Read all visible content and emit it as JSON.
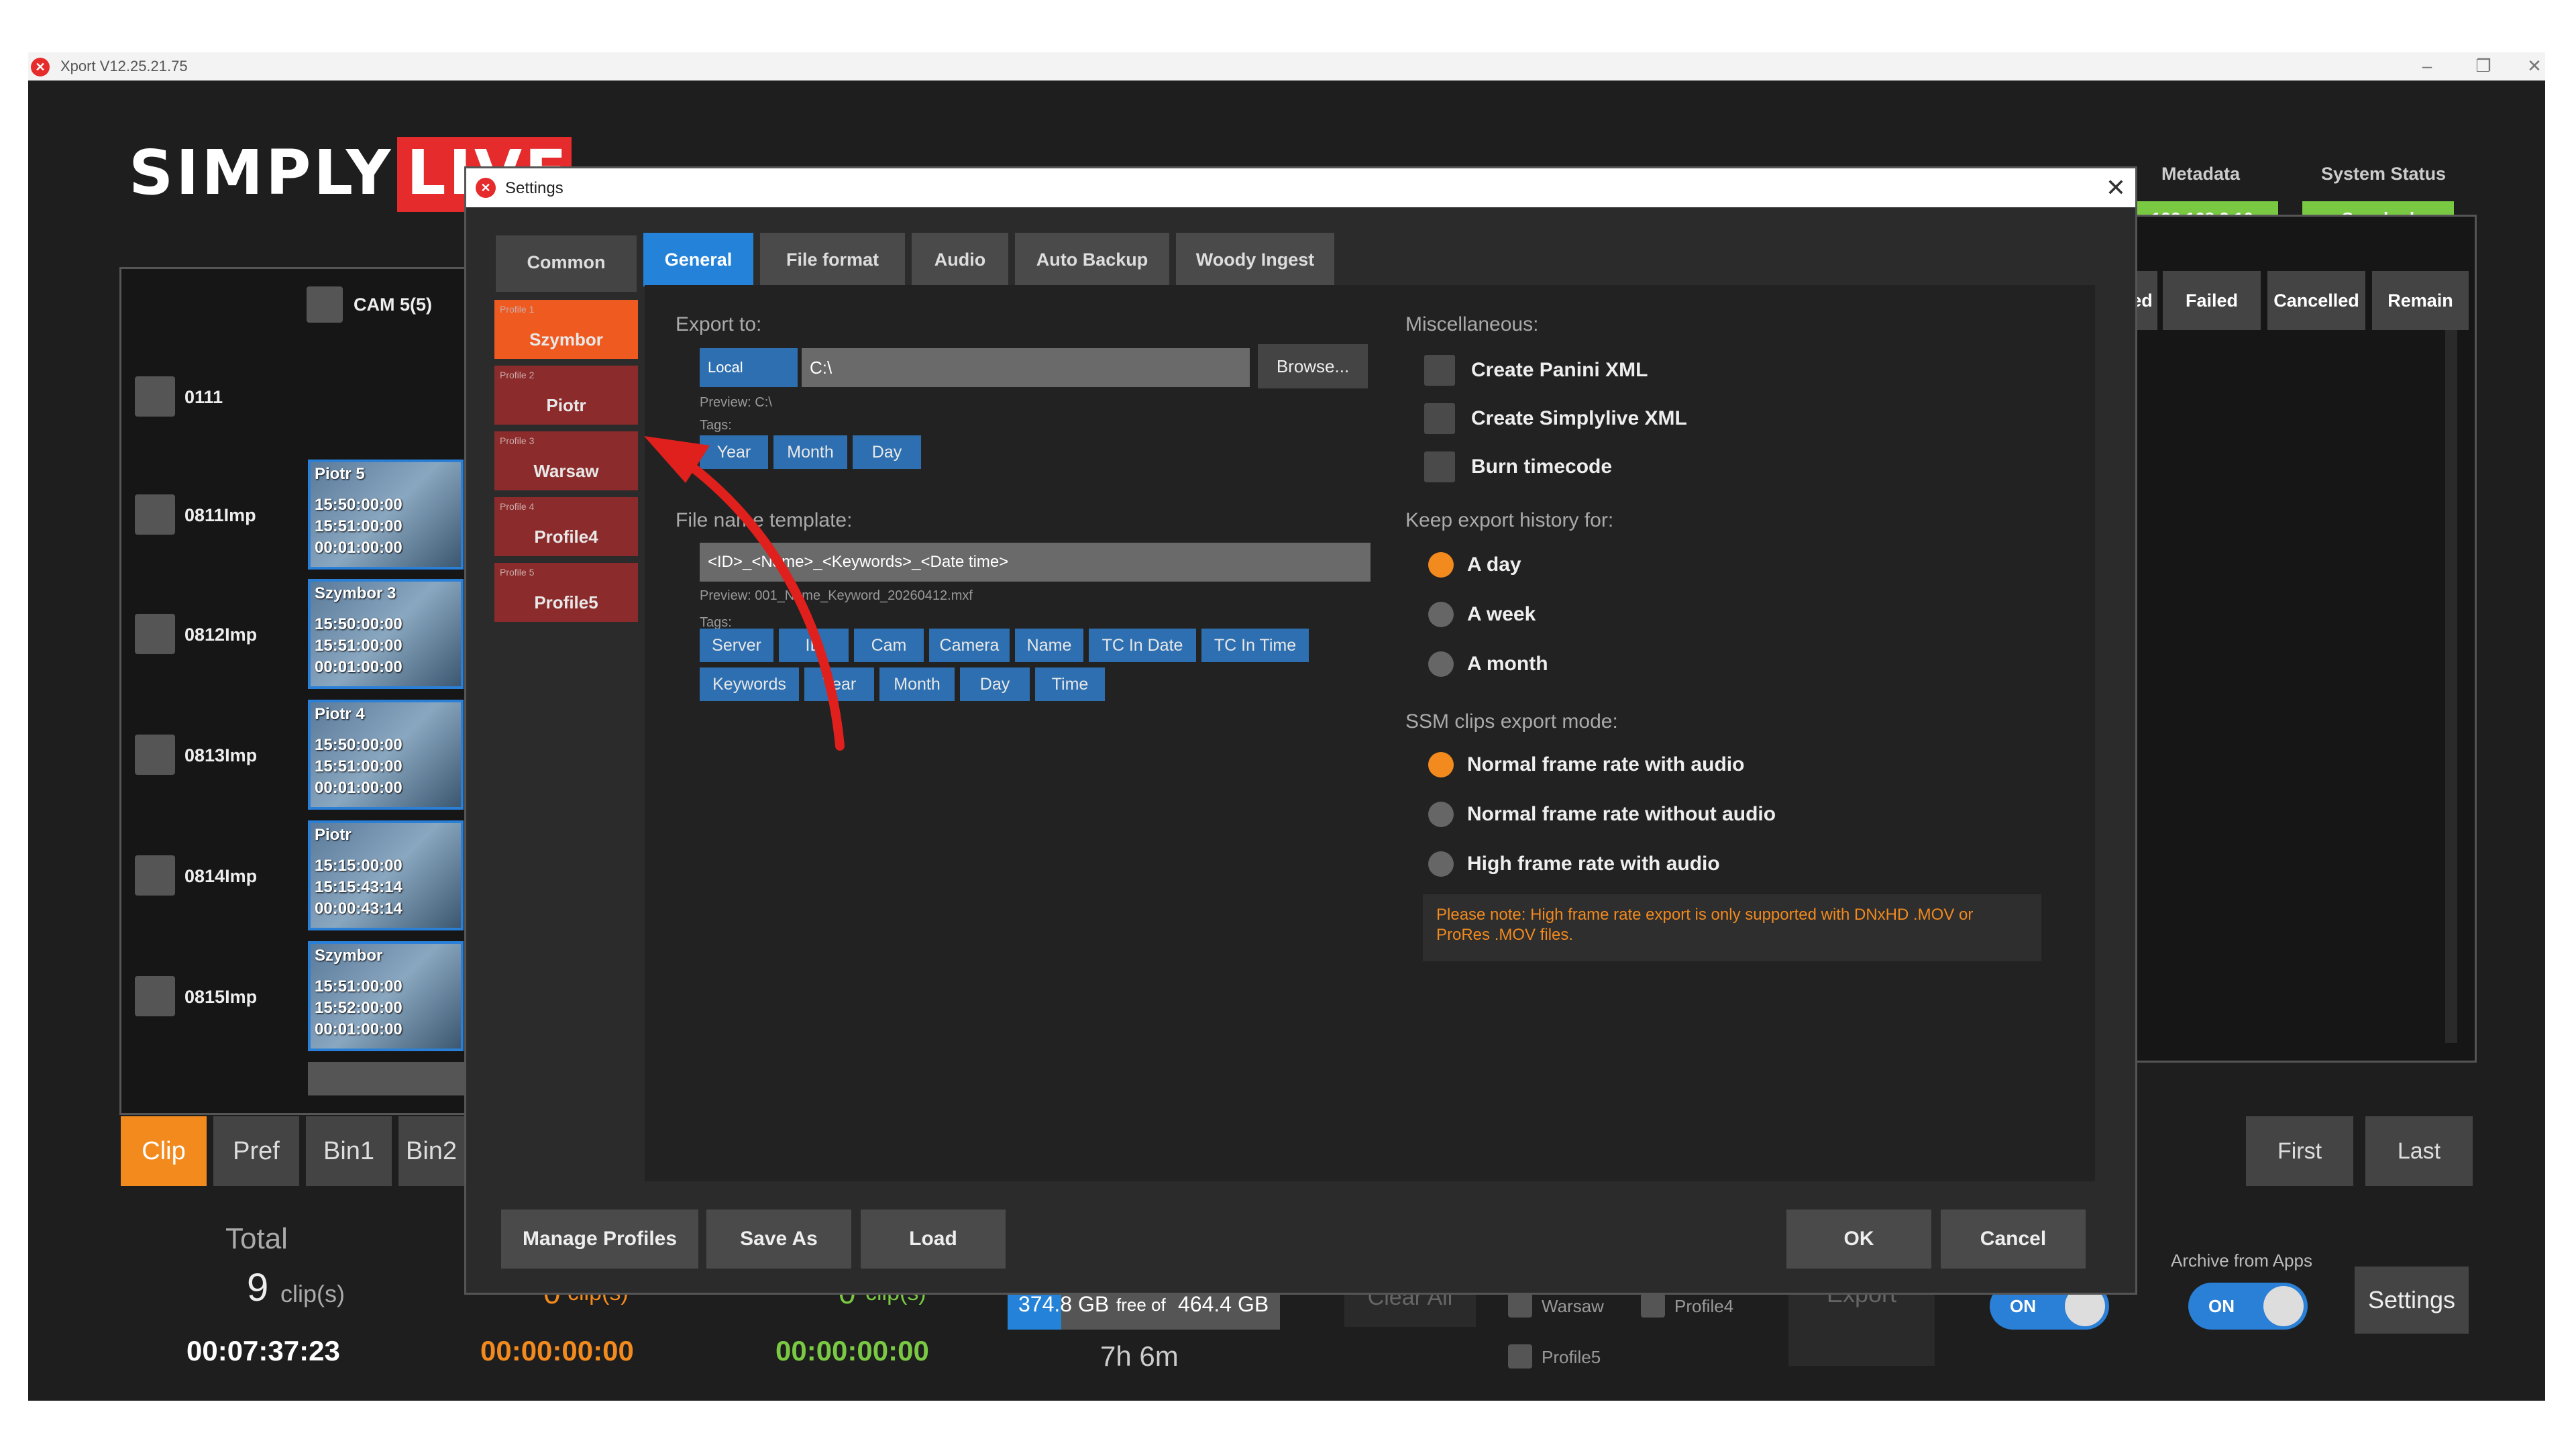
{
  "window": {
    "title": "Xport V12.25.21.75",
    "minimize": "–",
    "restore": "❐",
    "close": "✕"
  },
  "brand": {
    "part1": "SIMPLY",
    "part2": "LIVE"
  },
  "left_panel": {
    "camera_label": "CAM 5(5)",
    "rows": [
      {
        "label": "0111"
      },
      {
        "label": "0811Imp",
        "thumb": [
          "Piotr 5",
          "15:50:00:00",
          "15:51:00:00",
          "00:01:00:00"
        ]
      },
      {
        "label": "0812Imp",
        "thumb": [
          "Szymbor 3",
          "15:50:00:00",
          "15:51:00:00",
          "00:01:00:00"
        ]
      },
      {
        "label": "0813Imp",
        "thumb": [
          "Piotr 4",
          "15:50:00:00",
          "15:51:00:00",
          "00:01:00:00"
        ]
      },
      {
        "label": "0814Imp",
        "thumb": [
          "Piotr",
          "15:15:00:00",
          "15:15:43:14",
          "00:00:43:14"
        ]
      },
      {
        "label": "0815Imp",
        "thumb": [
          "Szymbor",
          "15:51:00:00",
          "15:52:00:00",
          "00:01:00:00"
        ]
      }
    ]
  },
  "right_panel": {
    "columns": [
      "ed",
      "Failed",
      "Cancelled",
      "Remain"
    ],
    "metadata_label": "Metadata",
    "metadata_value": "192.168.2.10",
    "status_label": "System Status",
    "status_value": "Synched"
  },
  "bottom": {
    "tabs": [
      "Clip",
      "Pref",
      "Bin1",
      "Bin2"
    ],
    "total_label": "Total",
    "total_count": "9",
    "clip_unit": "clip(s)",
    "total_time": "00:07:37:23",
    "col2_count": "0",
    "col2_time": "00:00:00:00",
    "col3_count": "0",
    "col3_time": "00:00:00:00",
    "disk": "374.8 GB",
    "disk_free": "free of",
    "disk_total": "464.4 GB",
    "remaining": "7h 6m",
    "clear_all": "Clear All",
    "profiles_list": [
      "Warsaw",
      "Profile4",
      "Profile5"
    ],
    "export": "Export",
    "toggle1": "ON",
    "archive_label": "Archive from Apps",
    "toggle2": "ON",
    "settings": "Settings",
    "first": "First",
    "last": "Last"
  },
  "dialog": {
    "title": "Settings",
    "close": "✕",
    "common_tab": "Common",
    "tabs": [
      "General",
      "File format",
      "Audio",
      "Auto Backup",
      "Woody Ingest"
    ],
    "profiles": [
      {
        "small": "Profile 1",
        "name": "Szymbor"
      },
      {
        "small": "Profile 2",
        "name": "Piotr"
      },
      {
        "small": "Profile 3",
        "name": "Warsaw"
      },
      {
        "small": "Profile 4",
        "name": "Profile4"
      },
      {
        "small": "Profile 5",
        "name": "Profile5"
      }
    ],
    "export_to": "Export to:",
    "location": "Local",
    "path": "C:\\",
    "browse": "Browse...",
    "preview_path": "Preview: C:\\",
    "tags_label": "Tags:",
    "path_tags": [
      "Year",
      "Month",
      "Day"
    ],
    "template_label": "File name template:",
    "template_value": "<ID>_<Name>_<Keywords>_<Date time>",
    "preview_name": "Preview: 001_Name_Keyword_20260412.mxf",
    "name_tags_row1": [
      "Server",
      "ID",
      "Cam",
      "Camera",
      "Name",
      "TC In Date",
      "TC In Time"
    ],
    "name_tags_row2": [
      "Keywords",
      "Year",
      "Month",
      "Day",
      "Time"
    ],
    "misc_label": "Miscellaneous:",
    "misc": [
      "Create Panini XML",
      "Create Simplylive XML",
      "Burn timecode"
    ],
    "history_label": "Keep export history for:",
    "history": [
      "A day",
      "A week",
      "A month"
    ],
    "history_selected": 0,
    "ssm_label": "SSM clips export mode:",
    "ssm": [
      "Normal frame rate with audio",
      "Normal frame rate without audio",
      "High frame rate with audio"
    ],
    "ssm_selected": 0,
    "note": "Please note: High frame rate export is only supported with DNxHD .MOV or ProRes .MOV files.",
    "buttons": {
      "manage": "Manage Profiles",
      "save_as": "Save As",
      "load": "Load",
      "ok": "OK",
      "cancel": "Cancel"
    }
  },
  "colors": {
    "accent_orange": "#f28a1e",
    "accent_blue": "#2483d8",
    "brand_red": "#e52b2b",
    "status_green": "#7ac943",
    "annotation_red": "#e0201c"
  }
}
